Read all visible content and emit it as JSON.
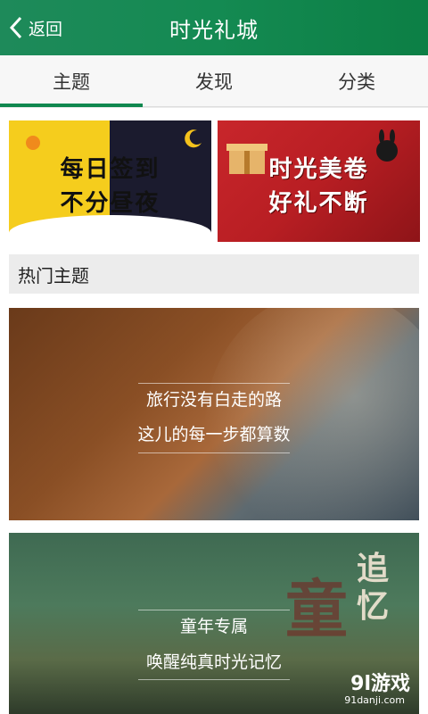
{
  "header": {
    "back_label": "返回",
    "title": "时光礼城"
  },
  "tabs": [
    {
      "label": "主题",
      "active": true
    },
    {
      "label": "发现",
      "active": false
    },
    {
      "label": "分类",
      "active": false
    }
  ],
  "banners": {
    "left": {
      "line1": "每日签到",
      "line2": "不分昼夜"
    },
    "right": {
      "line1": "时光美卷",
      "line2": "好礼不断"
    }
  },
  "section": {
    "title": "热门主题"
  },
  "cards": [
    {
      "line1": "旅行没有白走的路",
      "line2": "这儿的每一步都算数"
    },
    {
      "line1": "童年专属",
      "line2": "唤醒纯真时光记忆",
      "art_text": "追忆"
    }
  ],
  "watermark": {
    "main": "9l游戏",
    "sub": "91danji.com"
  },
  "colors": {
    "accent": "#10884f",
    "header_green": "#148a52"
  }
}
